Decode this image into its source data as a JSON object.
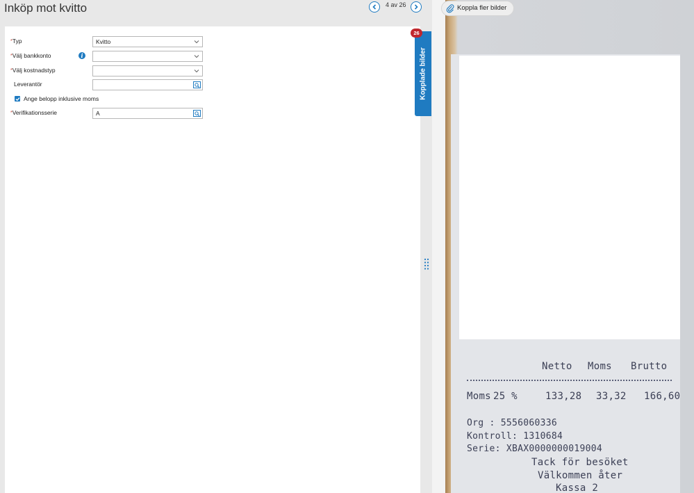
{
  "header": {
    "title": "Inköp mot kvitto",
    "pager_text": "4 av 26"
  },
  "form": {
    "required_marker": "*",
    "typ": {
      "label": "Typ",
      "value": "Kvitto"
    },
    "bankkonto": {
      "label": "Välj bankkonto",
      "value": ""
    },
    "kostnadstyp": {
      "label": "Välj kostnadstyp",
      "value": ""
    },
    "leverantor": {
      "label": "Leverantör",
      "value": ""
    },
    "moms_checkbox": {
      "label": "Ange belopp inklusive moms",
      "checked": true
    },
    "verifikationsserie": {
      "label": "Verifikationsserie",
      "value": "A"
    }
  },
  "side_tab": {
    "label": "Kopplade bilder",
    "badge": "26"
  },
  "info_icon": {
    "glyph": "i"
  },
  "attach": {
    "label": "Koppla fler bilder"
  },
  "receipt": {
    "col_netto": "Netto",
    "col_moms": "Moms",
    "col_brutto": "Brutto",
    "row_label": "Moms",
    "row_rate": "25 %",
    "row_netto": "133,28",
    "row_moms": "33,32",
    "row_brutto": "166,60",
    "line1": "Org : 5556060336",
    "line2": "Kontroll: 1310684",
    "line3": "Serie: XBAX0000000019004",
    "thanks": "Tack för besöket",
    "welcome": "Välkommen åter",
    "kassa": "Kassa 2"
  },
  "colors": {
    "accent": "#1f7bc1",
    "badge": "#c0272d",
    "required": "#c0392b"
  }
}
